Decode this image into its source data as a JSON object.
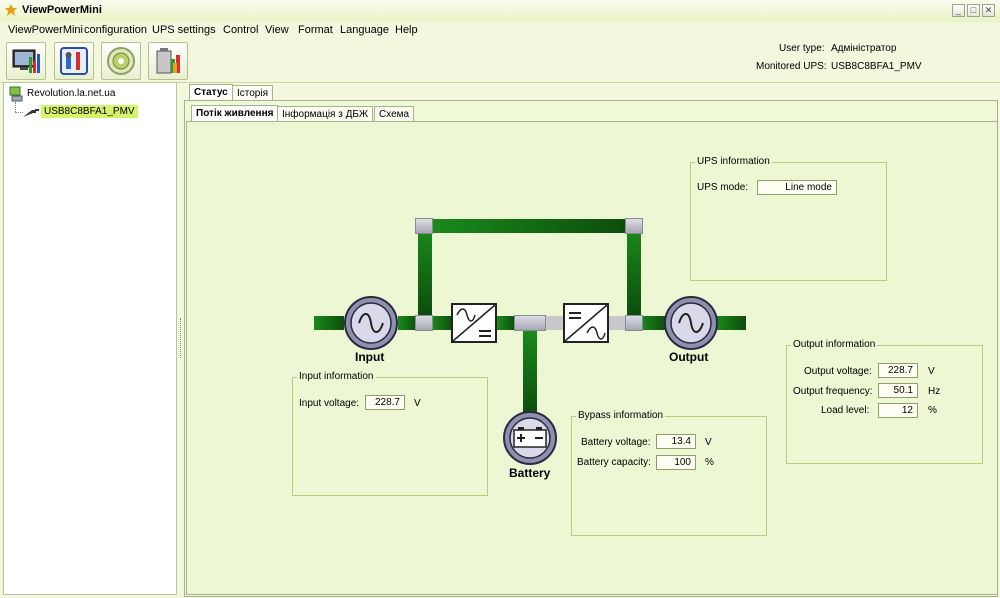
{
  "window": {
    "title": "ViewPowerMini"
  },
  "menu": [
    "ViewPowerMini",
    "configuration",
    "UPS settings",
    "Control",
    "View",
    "Format",
    "Language",
    "Help"
  ],
  "toolbar": {
    "buttons": [
      {
        "icon": "monitor-chart-icon"
      },
      {
        "icon": "tools-settings-icon"
      },
      {
        "icon": "disc-gear-icon"
      },
      {
        "icon": "battery-bars-icon"
      }
    ],
    "user_type_label": "User type:",
    "user_type_value": "Адміністратор",
    "monitored_ups_label": "Monitored UPS:",
    "monitored_ups_value": "USB8C8BFA1_PMV"
  },
  "tree": {
    "root": "Revolution.la.net.ua",
    "child": "USB8C8BFA1_PMV"
  },
  "tabs_top": [
    "Статус",
    "Історія"
  ],
  "tabs_sub": [
    "Потік живлення",
    "Інформація з ДБЖ",
    "Схема"
  ],
  "diagram": {
    "input_label": "Input",
    "output_label": "Output",
    "battery_label": "Battery"
  },
  "ups_info": {
    "title": "UPS information",
    "mode_label": "UPS mode:",
    "mode_value": "Line mode"
  },
  "input_info": {
    "title": "Input information",
    "voltage_label": "Input voltage:",
    "voltage_value": "228.7",
    "voltage_unit": "V"
  },
  "bypass_info": {
    "title": "Bypass information",
    "battery_voltage_label": "Battery voltage:",
    "battery_voltage_value": "13.4",
    "battery_voltage_unit": "V",
    "battery_capacity_label": "Battery capacity:",
    "battery_capacity_value": "100",
    "battery_capacity_unit": "%"
  },
  "output_info": {
    "title": "Output information",
    "voltage_label": "Output voltage:",
    "voltage_value": "228.7",
    "voltage_unit": "V",
    "frequency_label": "Output frequency:",
    "frequency_value": "50.1",
    "frequency_unit": "Hz",
    "load_label": "Load level:",
    "load_value": "12",
    "load_unit": "%"
  },
  "colors": {
    "accent_green": "#1a8a1a",
    "background": "#f2f7de",
    "highlight": "#d4f26a"
  }
}
